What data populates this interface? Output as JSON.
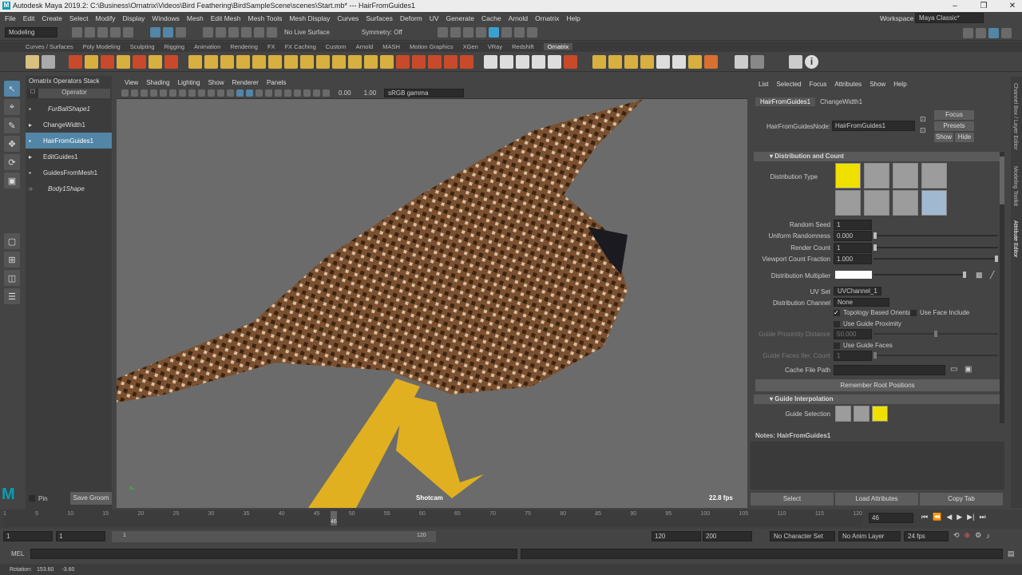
{
  "titlebar": {
    "title": "Autodesk Maya 2019.2: C:\\Business\\Ornatrix\\Videos\\Bird Feathering\\BirdSampleScene\\scenes\\Start.mb* --- HairFromGuides1"
  },
  "menubar": {
    "items": [
      "File",
      "Edit",
      "Create",
      "Select",
      "Modify",
      "Display",
      "Windows",
      "Mesh",
      "Edit Mesh",
      "Mesh Tools",
      "Mesh Display",
      "Curves",
      "Surfaces",
      "Deform",
      "UV",
      "Generate",
      "Cache",
      "Arnold",
      "Ornatrix",
      "Help"
    ],
    "workspace_label": "Workspace :",
    "workspace_value": "Maya Classic*"
  },
  "statusline": {
    "mode": "Modeling",
    "live_surface": "No Live Surface",
    "symmetry": "Symmetry: Off"
  },
  "shelf": {
    "tabs": [
      "Curves / Surfaces",
      "Poly Modeling",
      "Sculpting",
      "Rigging",
      "Animation",
      "Rendering",
      "FX",
      "FX Caching",
      "Custom",
      "Arnold",
      "MASH",
      "Motion Graphics",
      "XGen",
      "VRay",
      "Redshift",
      "Ornatrix"
    ],
    "active": "Ornatrix"
  },
  "outliner": {
    "title": "Ornatrix Operators Stack",
    "column": "Operator",
    "items": [
      {
        "label": "FurBallShape1",
        "italic": true
      },
      {
        "label": "ChangeWidth1"
      },
      {
        "label": "HairFromGuides1",
        "selected": true
      },
      {
        "label": "EditGuides1"
      },
      {
        "label": "GuidesFromMesh1"
      },
      {
        "label": "Body1Shape",
        "italic": true
      }
    ],
    "pin_label": "Pin",
    "save_groom_label": "Save Groom"
  },
  "viewport": {
    "menu": [
      "View",
      "Shading",
      "Lighting",
      "Show",
      "Renderer",
      "Panels"
    ],
    "exposure": "0.00",
    "gamma": "1.00",
    "colorspace": "sRGB gamma",
    "camera": "Shotcam",
    "fps": "22.8 fps"
  },
  "attr": {
    "menu": [
      "List",
      "Selected",
      "Focus",
      "Attributes",
      "Show",
      "Help"
    ],
    "tabs": [
      "HairFromGuides1",
      "ChangeWidth1"
    ],
    "node_label": "HairFromGuidesNode:",
    "node_value": "HairFromGuides1",
    "focus": "Focus",
    "presets": "Presets",
    "show": "Show",
    "hide": "Hide",
    "section_dist": "Distribution and Count",
    "dist_type_label": "Distribution Type",
    "random_seed_label": "Random Seed",
    "random_seed": "1",
    "uniform_label": "Uniform Randomness",
    "uniform": "0.000",
    "render_count_label": "Render Count",
    "render_count": "1",
    "viewport_frac_label": "Viewport Count Fraction",
    "viewport_frac": "1.000",
    "dist_mult_label": "Distribution Multiplier",
    "uvset_label": "UV Set",
    "uvset": "UVChannel_1",
    "dist_channel_label": "Distribution Channel",
    "dist_channel": "None",
    "topo_label": "Topology Based Orienta",
    "face_include_label": "Use Face Include",
    "use_guide_prox": "Use Guide Proximity",
    "guide_prox_label": "Guide Proximity Distance",
    "guide_prox": "50.000",
    "use_guide_faces": "Use Guide Faces",
    "guide_faces_label": "Guide Faces Iter. Count",
    "guide_faces": "1",
    "cache_label": "Cache File Path",
    "remember": "Remember Root Positions",
    "section_interp": "Guide Interpolation",
    "guide_sel_label": "Guide Selection",
    "notes": "Notes: HairFromGuides1",
    "bottom": [
      "Select",
      "Load Attributes",
      "Copy Tab"
    ],
    "side": [
      "Channel Box / Layer Editor",
      "Modeling Toolkit",
      "Attribute Editor"
    ]
  },
  "timeline": {
    "ticks": [
      "1",
      "5",
      "10",
      "15",
      "20",
      "25",
      "30",
      "35",
      "40",
      "45",
      "50",
      "55",
      "60",
      "65",
      "70",
      "75",
      "80",
      "85",
      "90",
      "95",
      "100",
      "105",
      "110",
      "115",
      "120"
    ],
    "current": "46",
    "current_field": "46"
  },
  "range": {
    "start": "1",
    "start2": "1",
    "slider_start": "1",
    "slider_end": "120",
    "end": "120",
    "end2": "200",
    "char_set": "No Character Set",
    "anim_layer": "No Anim Layer",
    "fps": "24 fps"
  },
  "cmd": {
    "lang": "MEL"
  },
  "help": {
    "rotation_label": "Rotation:",
    "rot_x": "153.60",
    "rot_y": "-3.60"
  },
  "colors": {
    "selected": "#5285a6",
    "yellow": "#f0e000"
  }
}
